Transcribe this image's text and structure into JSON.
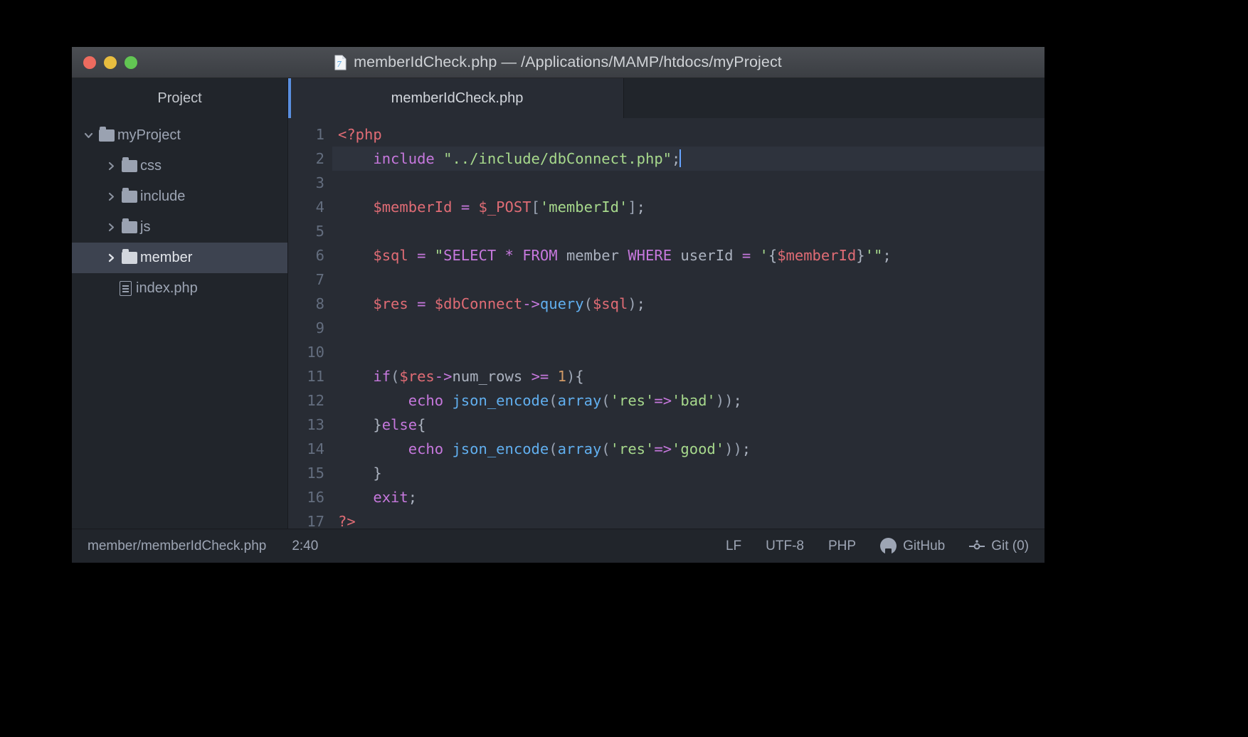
{
  "window": {
    "title": "memberIdCheck.php — /Applications/MAMP/htdocs/myProject",
    "doc_icon": "php-file-icon",
    "traffic_lights": {
      "close": "close-window-button",
      "minimize": "minimize-window-button",
      "maximize": "maximize-window-button"
    }
  },
  "sidebar": {
    "header": "Project",
    "items": [
      {
        "label": "myProject",
        "icon": "folder-icon",
        "chevron": "chevron-down-icon",
        "depth": 0,
        "selected": false,
        "type": "folder"
      },
      {
        "label": "css",
        "icon": "folder-icon",
        "chevron": "chevron-right-icon",
        "depth": 1,
        "selected": false,
        "type": "folder"
      },
      {
        "label": "include",
        "icon": "folder-icon",
        "chevron": "chevron-right-icon",
        "depth": 1,
        "selected": false,
        "type": "folder"
      },
      {
        "label": "js",
        "icon": "folder-icon",
        "chevron": "chevron-right-icon",
        "depth": 1,
        "selected": false,
        "type": "folder"
      },
      {
        "label": "member",
        "icon": "folder-icon",
        "chevron": "chevron-right-icon",
        "depth": 1,
        "selected": true,
        "type": "folder"
      },
      {
        "label": "index.php",
        "icon": "file-icon",
        "chevron": "",
        "depth": 2,
        "selected": false,
        "type": "file"
      }
    ]
  },
  "editor": {
    "tabs": [
      {
        "label": "memberIdCheck.php",
        "active": true
      }
    ],
    "active_line": 2,
    "cursor_line_number": 2,
    "line_numbers": [
      1,
      2,
      3,
      4,
      5,
      6,
      7,
      8,
      9,
      10,
      11,
      12,
      13,
      14,
      15,
      16,
      17
    ],
    "code_lines": [
      "<?php",
      "    include \"../include/dbConnect.php\";",
      "",
      "    $memberId = $_POST['memberId'];",
      "",
      "    $sql = \"SELECT * FROM member WHERE userId = '{$memberId}'\";",
      "",
      "    $res = $dbConnect->query($sql);",
      "",
      "",
      "    if($res->num_rows >= 1){",
      "        echo json_encode(array('res'=>'bad'));",
      "    }else{",
      "        echo json_encode(array('res'=>'good'));",
      "    }",
      "    exit;",
      "?>"
    ]
  },
  "statusbar": {
    "file_path": "member/memberIdCheck.php",
    "cursor_position": "2:40",
    "line_ending": "LF",
    "encoding": "UTF-8",
    "grammar": "PHP",
    "github": "GitHub",
    "git": "Git (0)",
    "github_icon": "github-icon",
    "git_icon": "git-branch-icon"
  },
  "colors": {
    "window_bg": "#282c34",
    "sidebar_bg": "#21252b",
    "titlebar_bg": "#3f4247",
    "accent": "#5a8fe0",
    "selected_row": "#3d4350",
    "keyword": "#c678dd",
    "string": "#a7d98c",
    "variable": "#e06c75",
    "function": "#61afef",
    "comment": "#636d7e",
    "text": "#abb2bf"
  }
}
